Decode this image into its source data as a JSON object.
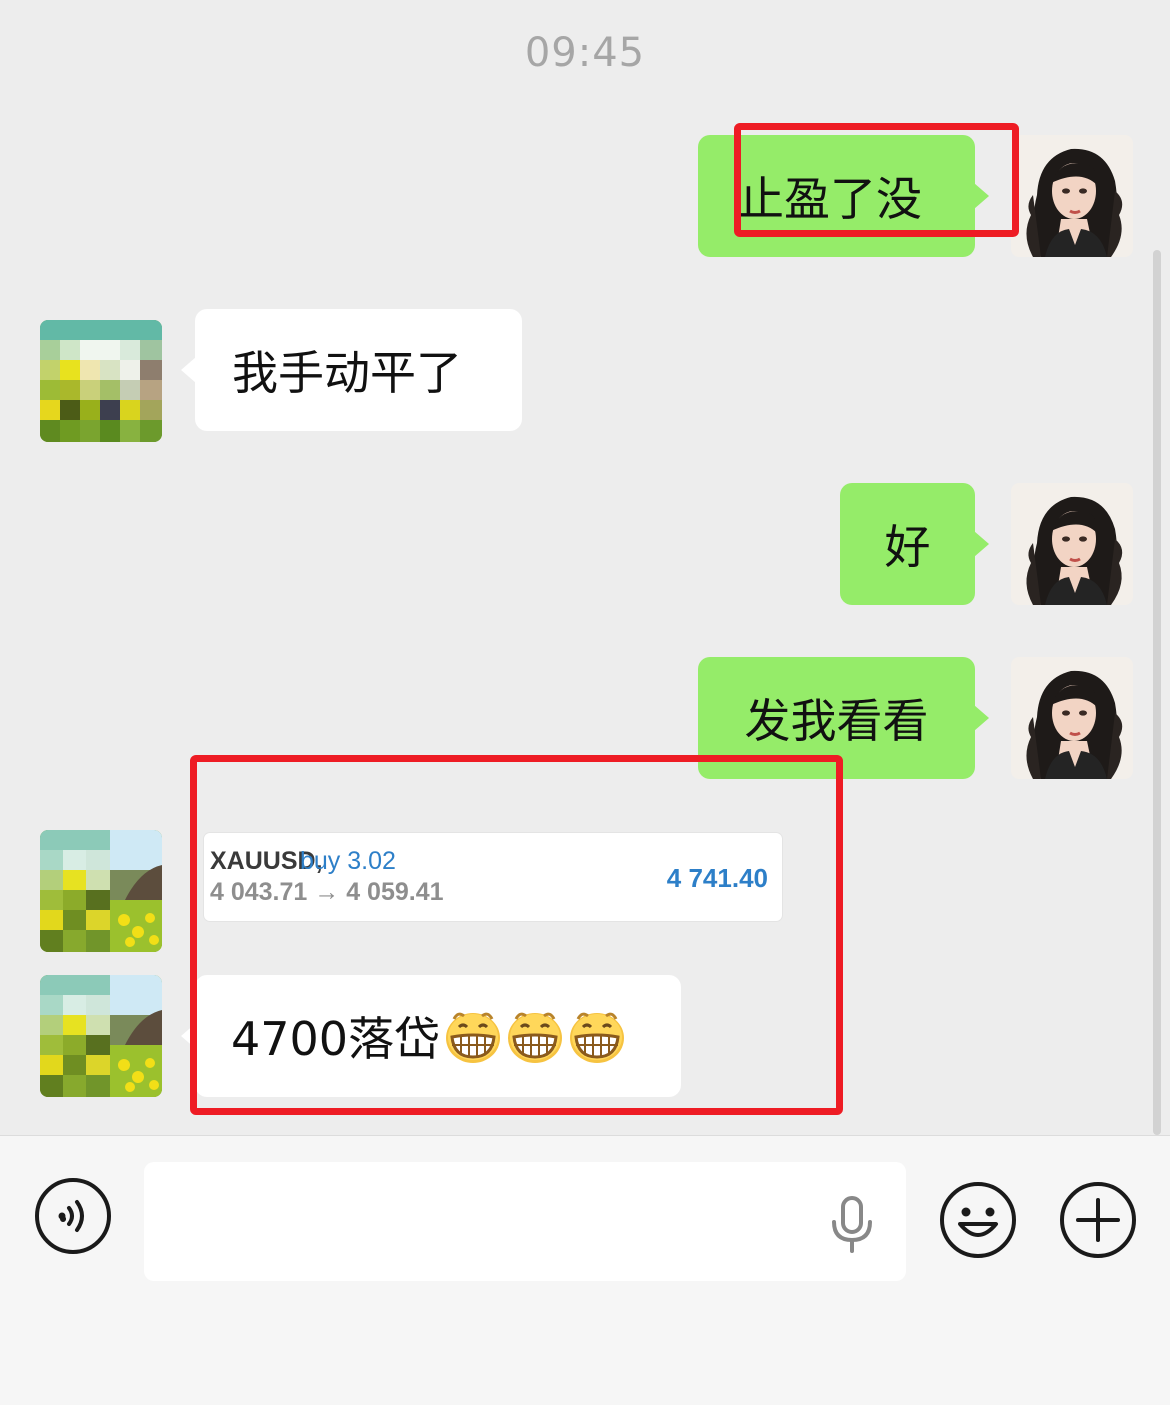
{
  "timestamp": "09:45",
  "messages": [
    {
      "sender": "me",
      "text": "止盈了没"
    },
    {
      "sender": "them",
      "text": "我手动平了"
    },
    {
      "sender": "me",
      "text": "好"
    },
    {
      "sender": "me",
      "text": "发我看看"
    },
    {
      "sender": "them",
      "type": "trade_card",
      "symbol": "XAUUSD,",
      "action": "buy 3.02",
      "prices": "4 043.71 → 4 059.41",
      "value": "4 741.40"
    },
    {
      "sender": "them",
      "text": "4700落岱",
      "emoji": [
        "grinning-face",
        "grinning-face",
        "grinning-face"
      ]
    }
  ],
  "input": {
    "value": "",
    "placeholder": ""
  },
  "icons": {
    "voice_toggle": "voice-message-icon",
    "mic": "microphone-icon",
    "emoji": "emoji-icon",
    "more": "plus-icon"
  },
  "colors": {
    "background": "#ededed",
    "my_bubble": "#95ec69",
    "their_bubble": "#ffffff",
    "annotation": "#ee1c24",
    "trade_blue": "#2d7fc8"
  }
}
